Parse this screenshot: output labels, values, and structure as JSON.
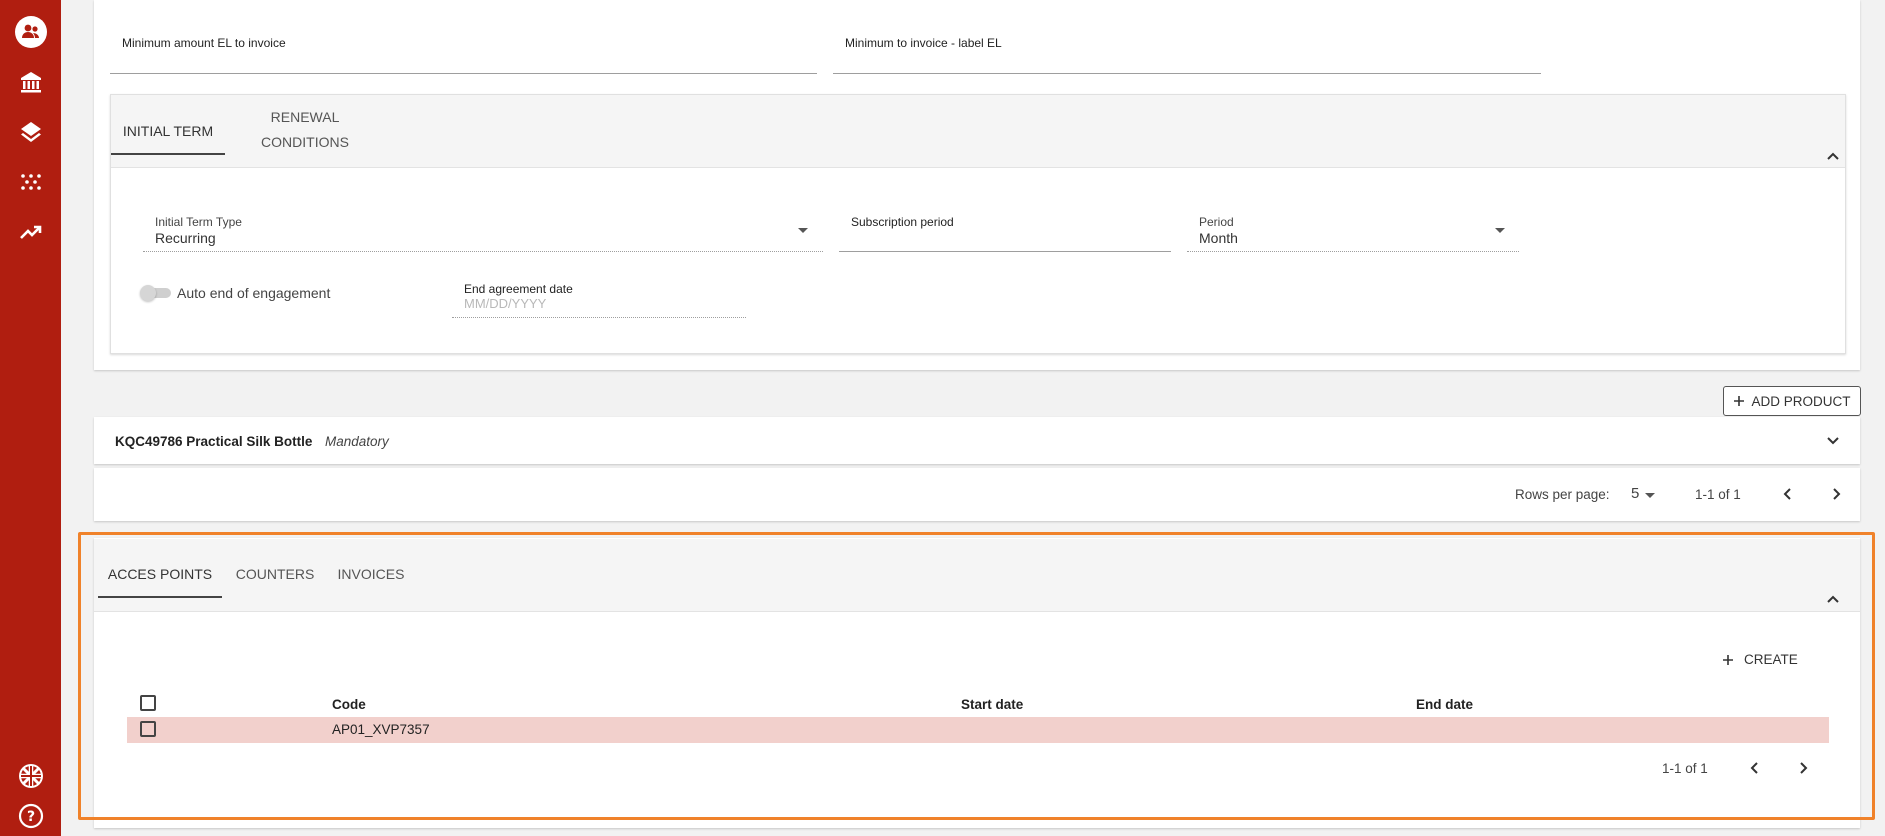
{
  "sidebar": {
    "icons": [
      "people-icon",
      "bank-icon",
      "layers-icon",
      "dots-grid-icon",
      "trending-up-icon"
    ],
    "bottom_icons": [
      "uk-flag-icon",
      "help-icon"
    ]
  },
  "top_fields": {
    "min_amount_label": "Minimum amount EL to invoice",
    "min_label_label": "Minimum to invoice - label EL"
  },
  "term_tabs": {
    "initial_term": "INITIAL TERM",
    "renewal_line1": "RENEWAL",
    "renewal_line2": "CONDITIONS"
  },
  "term_form": {
    "initial_term_type_label": "Initial Term Type",
    "initial_term_type_value": "Recurring",
    "subscription_period_label": "Subscription period",
    "period_label": "Period",
    "period_value": "Month",
    "auto_end_label": "Auto end of engagement",
    "end_agreement_label": "End agreement date",
    "end_agreement_placeholder": "MM/DD/YYYY"
  },
  "add_product_label": "ADD PRODUCT",
  "product": {
    "code": "KQC49786 Practical Silk Bottle",
    "tag": "Mandatory"
  },
  "products_pager": {
    "rows_per_page_label": "Rows per page:",
    "rows_per_page_value": "5",
    "range": "1-1 of 1"
  },
  "bottom_tabs": {
    "access_points": "ACCES POINTS",
    "counters": "COUNTERS",
    "invoices": "INVOICES"
  },
  "create_label": "CREATE",
  "access_table": {
    "columns": [
      "Code",
      "Start date",
      "End date"
    ],
    "rows": [
      {
        "code": "AP01_XVP7357",
        "start": "",
        "end": ""
      }
    ],
    "range": "1-1 of 1"
  },
  "colors": {
    "sidebar": "#b01e10",
    "highlight_row": "#f2d0cc",
    "focus_outline": "#f0822a"
  }
}
